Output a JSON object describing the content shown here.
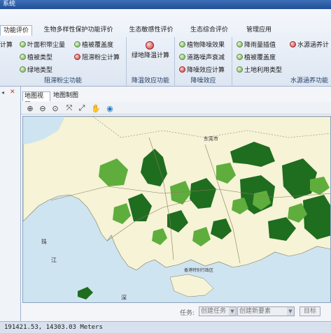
{
  "window": {
    "title": "系统"
  },
  "ribbon": {
    "tabs": [
      {
        "label": "功能评价",
        "active": true
      },
      {
        "label": "生物多样性保护功能评价"
      },
      {
        "label": "生态敏感性评价"
      },
      {
        "label": "生态综合评价"
      },
      {
        "label": "管理应用"
      }
    ],
    "group_dust": {
      "label": "阻滞粉尘功能",
      "items": [
        "计算",
        "叶面积带尘量",
        "植被覆盖度",
        "植被类型",
        "阻滞粉尘计算",
        "绿地类型"
      ]
    },
    "group_heat": {
      "label": "降温效应功能",
      "items": [
        "绿地降温计算"
      ]
    },
    "group_noise": {
      "label": "降噪效应",
      "items": [
        "植物降噪效果",
        "道路噪声衰减",
        "降噪效应计算"
      ]
    },
    "group_water": {
      "label": "水源涵养功能",
      "items": [
        "降雨量插值",
        "水源涵养计",
        "植被覆盖度",
        "土地利用类型"
      ]
    }
  },
  "panel": {
    "tabs": [
      {
        "label": "地图视图",
        "active": true
      },
      {
        "label": "地图制图"
      }
    ],
    "toolbar_icons": [
      "zoom-in-icon",
      "zoom-out-icon",
      "zoom-extent-icon",
      "fixed-zoom-in-icon",
      "fixed-zoom-out-icon",
      "pan-hand-icon",
      "globe-icon"
    ],
    "map_labels": {
      "city": "东莞市",
      "hk": "香港特别行政区",
      "river1": "珠",
      "river2": "江",
      "sea": "深"
    },
    "task": {
      "label": "任务:",
      "task_value": "创建任务",
      "feature_value": "创建新要素",
      "button": "目标"
    }
  },
  "status": {
    "coords": "191421.53, 14303.03  Meters"
  },
  "colors": {
    "land": "#f6f3d6",
    "water": "#cfe4f1",
    "forest_dark": "#1f6d1f",
    "forest_light": "#5fae3d"
  }
}
